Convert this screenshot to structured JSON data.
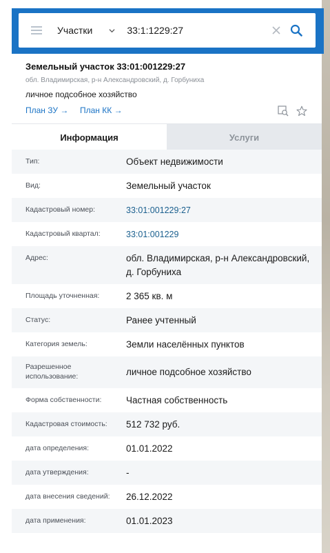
{
  "search": {
    "layer": "Участки",
    "value": "33:1:1229:27"
  },
  "object": {
    "title": "Земельный участок 33:01:001229:27",
    "address": "обл. Владимирская, р-н Александровский, д. Горбуниха",
    "usage": "личное подсобное хозяйство",
    "link_plan_zu": "План ЗУ →",
    "link_plan_kk": "План КК →"
  },
  "tabs": {
    "info": "Информация",
    "services": "Услуги"
  },
  "fields": [
    {
      "label": "Тип:",
      "value": "Объект недвижимости"
    },
    {
      "label": "Вид:",
      "value": "Земельный участок"
    },
    {
      "label": "Кадастровый номер:",
      "value": "33:01:001229:27"
    },
    {
      "label": "Кадастровый квартал:",
      "value": "33:01:001229"
    },
    {
      "label": "Адрес:",
      "value": "обл. Владимирская, р-н Александровский, д. Горбуниха"
    },
    {
      "label": "Площадь уточненная:",
      "value": "2 365 кв. м"
    },
    {
      "label": "Статус:",
      "value": "Ранее учтенный"
    },
    {
      "label": "Категория земель:",
      "value": "Земли населённых пунктов"
    },
    {
      "label": "Разрешенное использование:",
      "value": "личное подсобное хозяйство"
    },
    {
      "label": "Форма собственности:",
      "value": "Частная собственность"
    },
    {
      "label": "Кадастровая стоимость:",
      "value": "512 732 руб."
    },
    {
      "label": "дата определения:",
      "value": "01.01.2022"
    },
    {
      "label": "дата утверждения:",
      "value": "-"
    },
    {
      "label": "дата внесения сведений:",
      "value": "26.12.2022"
    },
    {
      "label": "дата применения:",
      "value": "01.01.2023"
    }
  ],
  "icons": {
    "menu": "burger-menu-icon",
    "chevron": "chevron-down-icon",
    "clear": "close-icon",
    "search": "search-icon",
    "locate": "map-locate-icon",
    "favorite": "star-icon"
  },
  "colors": {
    "header": "#1a73c5",
    "link": "#1a73c5",
    "tab_inactive_bg": "#e6e9ed"
  }
}
